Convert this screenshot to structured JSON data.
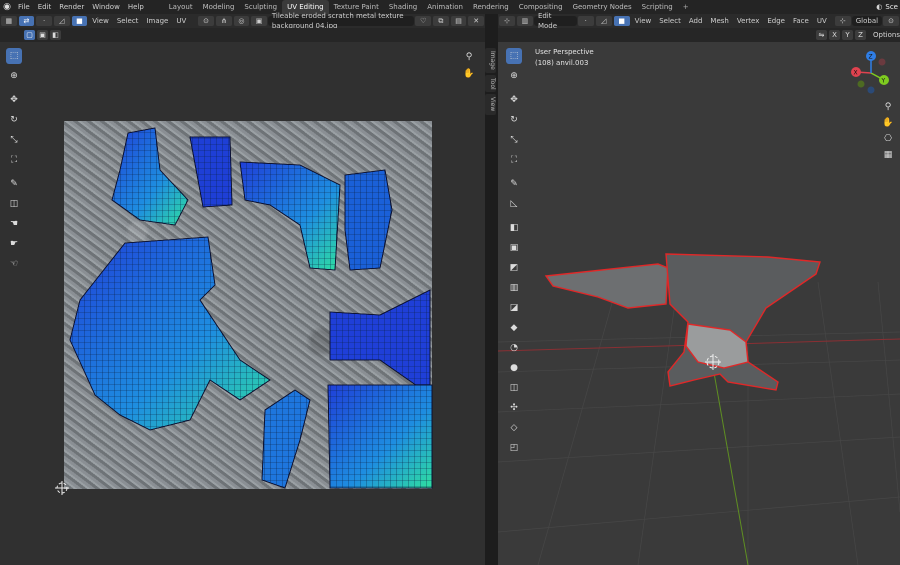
{
  "topbar": {
    "menus": [
      "File",
      "Edit",
      "Render",
      "Window",
      "Help"
    ],
    "workspaces": [
      "Layout",
      "Modeling",
      "Sculpting",
      "UV Editing",
      "Texture Paint",
      "Shading",
      "Animation",
      "Rendering",
      "Compositing",
      "Geometry Nodes",
      "Scripting"
    ],
    "active_workspace": "UV Editing",
    "scene_label": "Sce"
  },
  "uv_editor": {
    "header_menus": [
      "View",
      "Select",
      "Image",
      "UV"
    ],
    "image_name": "Tileable eroded scratch metal texture background 04.jpg",
    "side_tabs": [
      "Image",
      "Tool",
      "View"
    ]
  },
  "viewport": {
    "mode": "Edit Mode",
    "header_menus": [
      "View",
      "Select",
      "Add",
      "Mesh",
      "Vertex",
      "Edge",
      "Face",
      "UV"
    ],
    "orientation": "Global",
    "axes": [
      "X",
      "Y",
      "Z"
    ],
    "options_label": "Options",
    "perspective": "User Perspective",
    "object": "(108) anvil.003",
    "gizmo_axes": {
      "x": "X",
      "y": "Y",
      "z": "Z"
    }
  },
  "colors": {
    "accent": "#4772b3",
    "selection": "#e02828",
    "x_axis": "#e0424f",
    "y_axis": "#7ecb20",
    "z_axis": "#2f7ee6"
  }
}
